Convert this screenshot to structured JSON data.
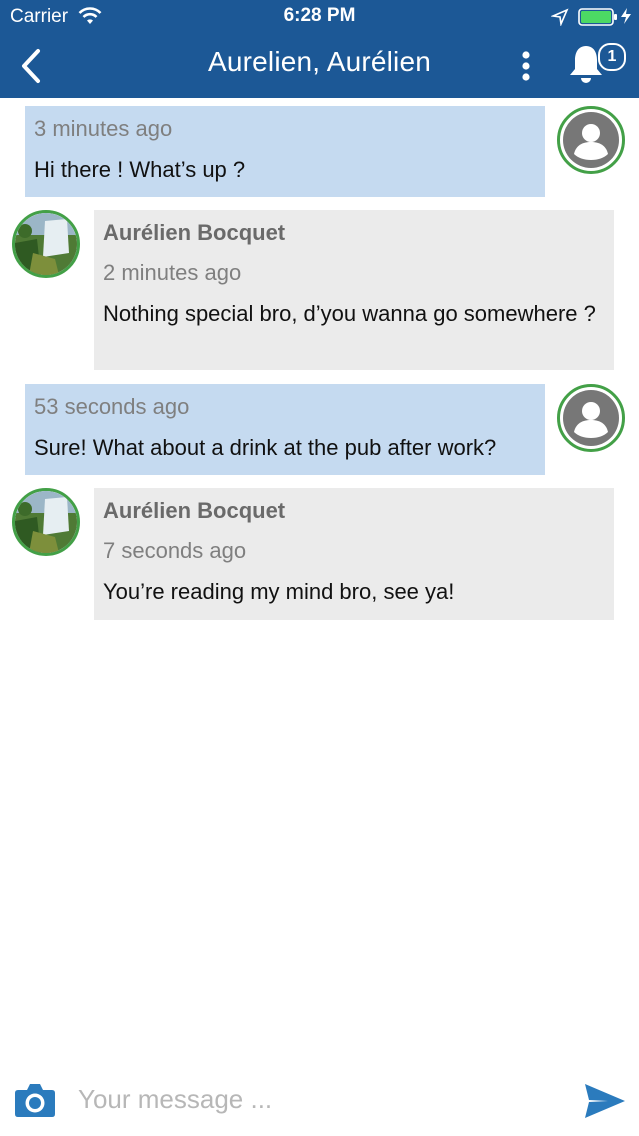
{
  "status_bar": {
    "carrier": "Carrier",
    "time": "6:28 PM"
  },
  "nav": {
    "title": "Aurelien, Aurélien",
    "notification_count": "1"
  },
  "colors": {
    "header": "#1c5896",
    "mine_bubble": "#c5daf0",
    "theirs_bubble": "#ebebeb",
    "avatar_ring": "#43a047"
  },
  "icons": {
    "back": "chevron-left-icon",
    "more": "vertical-dots-icon",
    "bell": "bell-icon",
    "camera": "camera-icon",
    "send": "send-icon"
  },
  "messages": [
    {
      "from": "me",
      "time": "3 minutes ago",
      "text": "Hi there ! What’s up ?"
    },
    {
      "from": "other",
      "sender": "Aurélien Bocquet",
      "time": "2 minutes ago",
      "text": "Nothing special bro, d’you wanna go somewhere ?"
    },
    {
      "from": "me",
      "time": "53 seconds ago",
      "text": "Sure! What about a drink at the pub after work?"
    },
    {
      "from": "other",
      "sender": "Aurélien Bocquet",
      "time": "7 seconds ago",
      "text": "You’re reading my mind bro, see ya!"
    }
  ],
  "composer": {
    "placeholder": "Your message ..."
  }
}
